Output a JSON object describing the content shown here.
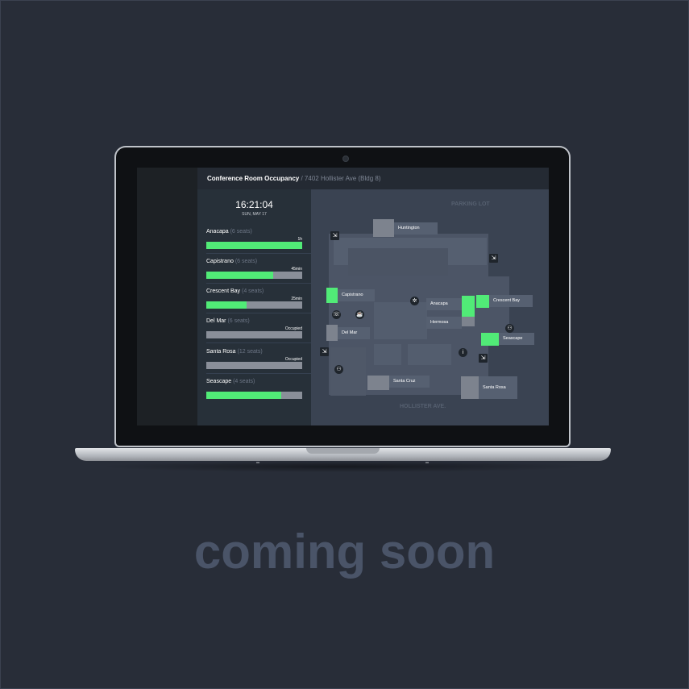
{
  "app": {
    "title": "Conference Room Occupancy",
    "separator": " / ",
    "location": "7402 Hollister Ave (Bldg 8)"
  },
  "clock": {
    "time": "16:21:04",
    "date": "SUN, MAY 17"
  },
  "rooms": [
    {
      "name": "Anacapa",
      "seats": "(6 seats)",
      "status": "1h",
      "fill": 1.0
    },
    {
      "name": "Capistrano",
      "seats": "(6 seats)",
      "status": "45min",
      "fill": 0.7
    },
    {
      "name": "Crescent Bay",
      "seats": "(4 seats)",
      "status": "25min",
      "fill": 0.42
    },
    {
      "name": "Del Mar",
      "seats": "(6 seats)",
      "status": "Occupied",
      "fill": 0
    },
    {
      "name": "Santa Rosa",
      "seats": "(12 seats)",
      "status": "Occupied",
      "fill": 0
    },
    {
      "name": "Seascape",
      "seats": "(4 seats)",
      "status": "",
      "fill": 0.78
    }
  ],
  "map": {
    "top_label": "PARKING LOT",
    "bottom_label": "HOLLISTER AVE.",
    "rooms": {
      "huntington": "Huntington",
      "capistrano": "Capistrano",
      "anacapa": "Anacapa",
      "crescent_bay": "Crescent Bay",
      "hermosa": "Hermosa",
      "del_mar": "Del Mar",
      "seascape": "Seascape",
      "santa_cruz": "Santa Cruz",
      "santa_rosa": "Santa Rosa"
    }
  },
  "footer": {
    "text": "coming soon"
  },
  "colors": {
    "available": "#51eb77",
    "occupied": "#8a8f99",
    "background": "#282d38"
  }
}
